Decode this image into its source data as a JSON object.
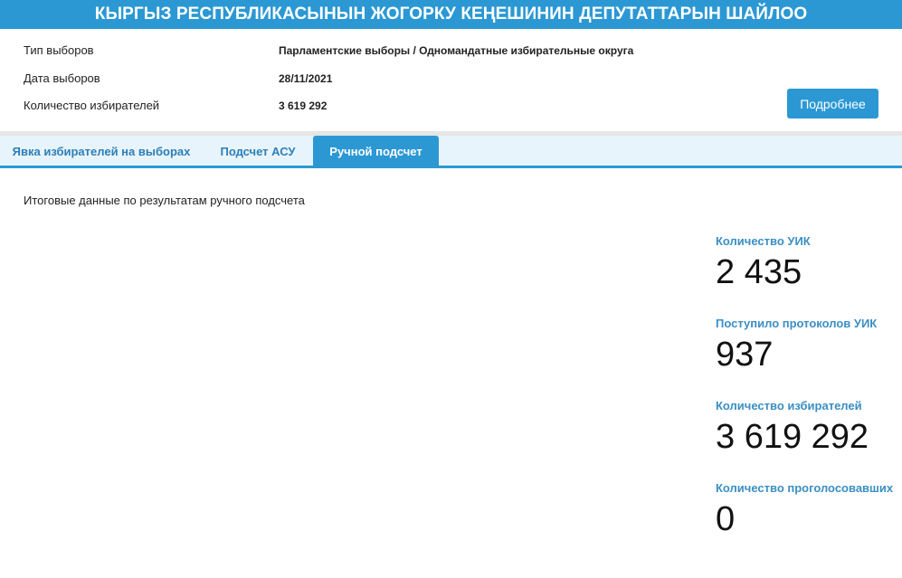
{
  "header": {
    "title": "КЫРГЫЗ РЕСПУБЛИКАСЫНЫН ЖОГОРКУ КЕҢЕШИНИН ДЕПУТАТТАРЫН ШАЙЛОО"
  },
  "info": {
    "rows": [
      {
        "label": "Тип выборов",
        "value": "Парламентские выборы / Одномандатные избирательные округа"
      },
      {
        "label": "Дата выборов",
        "value": "28/11/2021"
      },
      {
        "label": "Количество избирателей",
        "value": "3 619 292"
      }
    ],
    "more_button": "Подробнее"
  },
  "tabs": [
    {
      "label": "Явка избирателей на выборах",
      "active": false
    },
    {
      "label": "Подсчет АСУ",
      "active": false
    },
    {
      "label": "Ручной подсчет",
      "active": true
    }
  ],
  "main": {
    "subtitle": "Итоговые данные по результатам ручного подсчета",
    "stats": [
      {
        "label": "Количество УИК",
        "value": "2 435"
      },
      {
        "label": "Поступило протоколов УИК",
        "value": "937"
      },
      {
        "label": "Количество избирателей",
        "value": "3 619 292"
      },
      {
        "label": "Количество проголосовавших",
        "value": "0"
      }
    ]
  },
  "colors": {
    "accent": "#2b98d4",
    "tab_bar_bg": "#e8f4fb",
    "stat_label": "#3a8fc4",
    "divider": "#e6e6e6"
  }
}
